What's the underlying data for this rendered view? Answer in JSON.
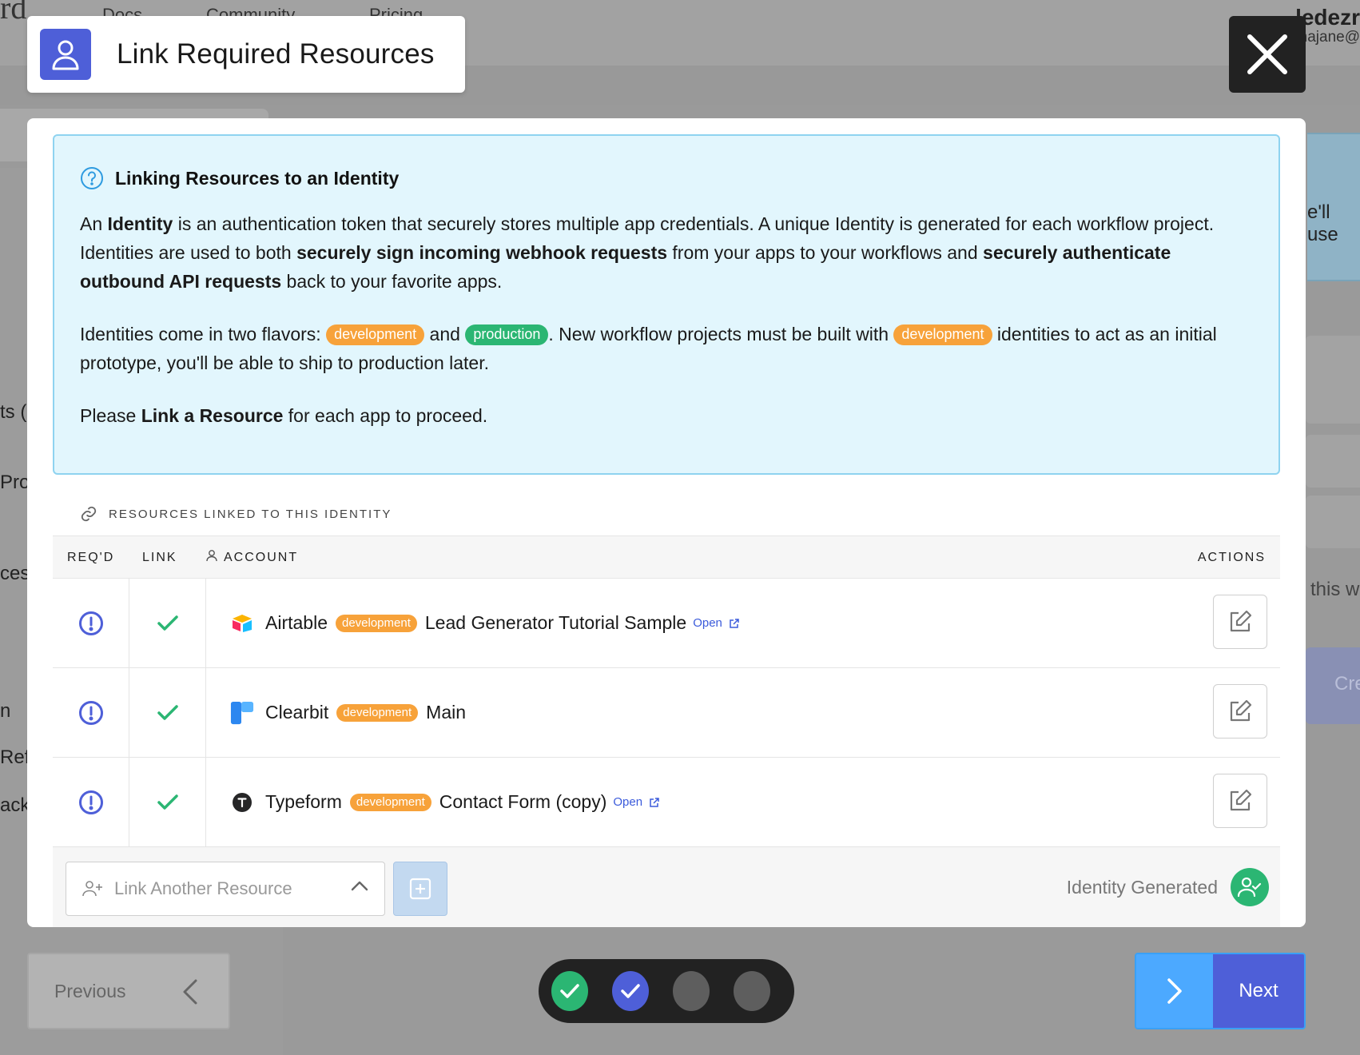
{
  "background": {
    "logo": "rd",
    "nav": [
      "Docs",
      "Community",
      "Pricing"
    ],
    "user_name": "ledezr",
    "user_email": "najane@",
    "side_texts": [
      "ts (",
      "Proj",
      "ces",
      "n",
      "Ref",
      "ack"
    ],
    "right_texts": [
      "e'll use",
      "this w"
    ],
    "create_label": "Cre"
  },
  "header": {
    "title": "Link Required Resources"
  },
  "info": {
    "title": "Linking Resources to an Identity",
    "p1": {
      "t1": "An ",
      "b1": "Identity",
      "t2": " is an authentication token that securely stores multiple app credentials. A unique Identity is generated for each workflow project. Identities are used to both ",
      "b2": "securely sign incoming webhook requests",
      "t3": " from your apps to your workflows and ",
      "b3": "securely authenticate outbound API requests",
      "t4": " back to your favorite apps."
    },
    "p2": {
      "t1": "Identities come in two flavors: ",
      "pill_dev": "development",
      "t2": " and ",
      "pill_prod": "production",
      "t3": ". New workflow projects must be built with ",
      "pill_dev2": "development",
      "t4": " identities to act as an initial prototype, you'll be able to ship to production later."
    },
    "p3": {
      "t1": "Please ",
      "b1": "Link a Resource",
      "t2": " for each app to proceed."
    }
  },
  "resources": {
    "section_label": "RESOURCES LINKED TO THIS IDENTITY",
    "columns": {
      "req": "REQ'D",
      "link": "LINK",
      "account": "ACCOUNT",
      "actions": "ACTIONS"
    },
    "rows": [
      {
        "app": "Airtable",
        "env": "development",
        "account": "Lead Generator Tutorial Sample",
        "open": "Open"
      },
      {
        "app": "Clearbit",
        "env": "development",
        "account": "Main",
        "open": ""
      },
      {
        "app": "Typeform",
        "env": "development",
        "account": "Contact Form (copy)",
        "open": "Open"
      }
    ]
  },
  "footer": {
    "link_placeholder": "Link Another Resource",
    "identity_status": "Identity Generated"
  },
  "nav": {
    "previous": "Previous",
    "next": "Next",
    "steps": [
      "done",
      "current",
      "todo",
      "todo"
    ]
  },
  "colors": {
    "brand": "#4e5fd8",
    "success": "#2bb673",
    "dev": "#f7a23a",
    "info_bg": "#e2f6fd"
  }
}
